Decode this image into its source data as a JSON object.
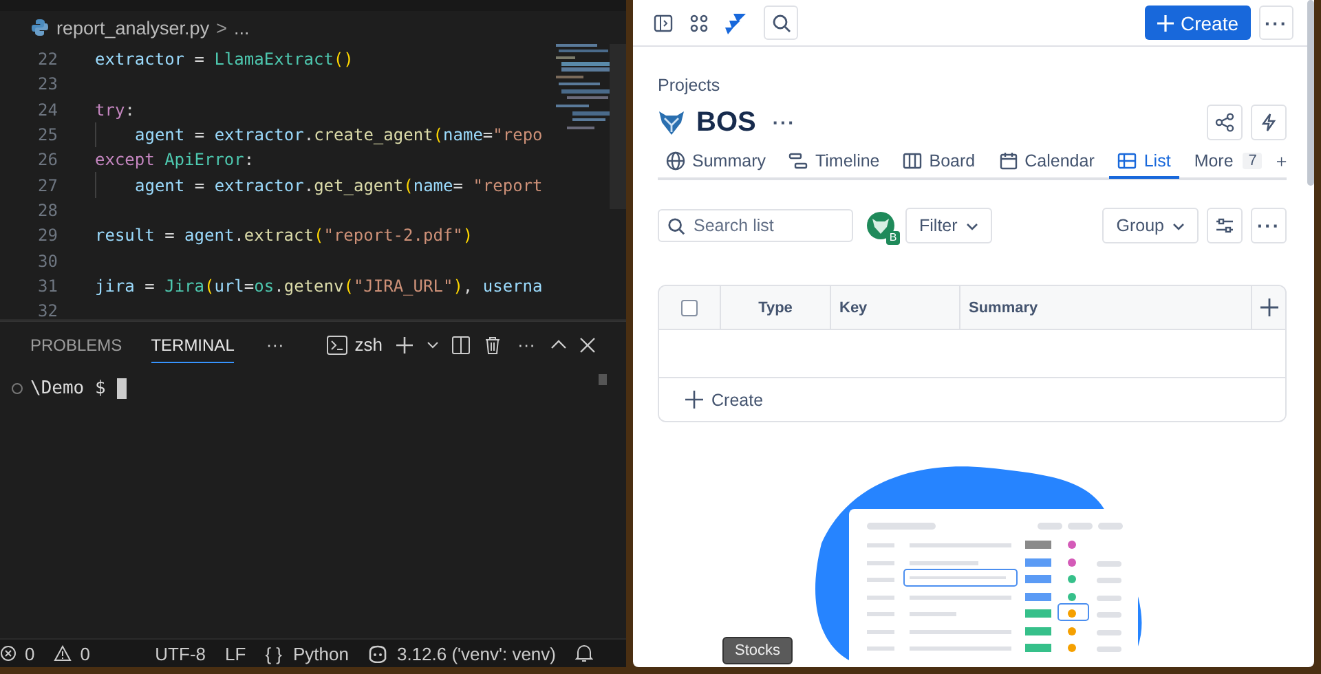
{
  "editor": {
    "breadcrumb": {
      "file": "report_analyser.py",
      "separator": ">",
      "rest": "..."
    },
    "lines": [
      {
        "number": "22",
        "indent": false,
        "tokens": [
          {
            "kind": "var",
            "text": "extractor"
          },
          {
            "kind": "plain",
            "text": " = "
          },
          {
            "kind": "class",
            "text": "LlamaExtract"
          },
          {
            "kind": "paren",
            "text": "()"
          }
        ]
      },
      {
        "number": "23",
        "indent": false
      },
      {
        "number": "24",
        "indent": false,
        "tokens": [
          {
            "kind": "keyword",
            "text": "try"
          },
          {
            "kind": "plain",
            "text": ":"
          }
        ]
      },
      {
        "number": "25",
        "indent": true,
        "tokens": [
          {
            "kind": "var",
            "text": "agent"
          },
          {
            "kind": "plain",
            "text": " = "
          },
          {
            "kind": "var",
            "text": "extractor"
          },
          {
            "kind": "plain",
            "text": "."
          },
          {
            "kind": "func",
            "text": "create_agent"
          },
          {
            "kind": "paren",
            "text": "("
          },
          {
            "kind": "var",
            "text": "name"
          },
          {
            "kind": "plain",
            "text": "="
          },
          {
            "kind": "string",
            "text": "\"repo"
          }
        ]
      },
      {
        "number": "26",
        "indent": false,
        "tokens": [
          {
            "kind": "keyword",
            "text": "except"
          },
          {
            "kind": "class",
            "text": " ApiError"
          },
          {
            "kind": "plain",
            "text": ":"
          }
        ]
      },
      {
        "number": "27",
        "indent": true,
        "tokens": [
          {
            "kind": "var",
            "text": "agent"
          },
          {
            "kind": "plain",
            "text": " = "
          },
          {
            "kind": "var",
            "text": "extractor"
          },
          {
            "kind": "plain",
            "text": "."
          },
          {
            "kind": "func",
            "text": "get_agent"
          },
          {
            "kind": "paren",
            "text": "("
          },
          {
            "kind": "var",
            "text": "name"
          },
          {
            "kind": "plain",
            "text": "= "
          },
          {
            "kind": "string",
            "text": "\"report"
          }
        ]
      },
      {
        "number": "28",
        "indent": false
      },
      {
        "number": "29",
        "indent": false,
        "tokens": [
          {
            "kind": "var",
            "text": "result"
          },
          {
            "kind": "plain",
            "text": " = "
          },
          {
            "kind": "var",
            "text": "agent"
          },
          {
            "kind": "plain",
            "text": "."
          },
          {
            "kind": "func",
            "text": "extract"
          },
          {
            "kind": "paren",
            "text": "("
          },
          {
            "kind": "string",
            "text": "\"report-2.pdf\""
          },
          {
            "kind": "paren",
            "text": ")"
          }
        ]
      },
      {
        "number": "30",
        "indent": false
      },
      {
        "number": "31",
        "indent": false,
        "tokens": [
          {
            "kind": "var",
            "text": "jira"
          },
          {
            "kind": "plain",
            "text": " = "
          },
          {
            "kind": "class",
            "text": "Jira"
          },
          {
            "kind": "paren",
            "text": "("
          },
          {
            "kind": "var",
            "text": "url"
          },
          {
            "kind": "plain",
            "text": "="
          },
          {
            "kind": "class",
            "text": "os"
          },
          {
            "kind": "plain",
            "text": "."
          },
          {
            "kind": "func",
            "text": "getenv"
          },
          {
            "kind": "paren",
            "text": "("
          },
          {
            "kind": "string",
            "text": "\"JIRA_URL\""
          },
          {
            "kind": "paren",
            "text": ")"
          },
          {
            "kind": "plain",
            "text": ", "
          },
          {
            "kind": "var",
            "text": "userna"
          }
        ]
      },
      {
        "number": "32",
        "indent": false
      }
    ]
  },
  "panel": {
    "tabs": [
      {
        "label": "PROBLEMS",
        "selected": false
      },
      {
        "label": "TERMINAL",
        "selected": true
      }
    ],
    "more": "···",
    "shell": "zsh",
    "actions_more": "···"
  },
  "terminal": {
    "prompt": "\\Demo $"
  },
  "status_bar": {
    "errors": "0",
    "warnings": "0",
    "encoding": "UTF-8",
    "eol": "LF",
    "language_icon": "{ }",
    "language": "Python",
    "interpreter": "3.12.6 ('venv': venv)"
  },
  "jira": {
    "create_button": "Create",
    "more": "···",
    "breadcrumb": "Projects",
    "project": "BOS",
    "project_more": "···",
    "tabs": [
      {
        "label": "Summary",
        "selected": false
      },
      {
        "label": "Timeline",
        "selected": false
      },
      {
        "label": "Board",
        "selected": false
      },
      {
        "label": "Calendar",
        "selected": false
      },
      {
        "label": "List",
        "selected": true
      }
    ],
    "more_tab": {
      "label": "More",
      "count": "7"
    },
    "search": {
      "placeholder": "Search list"
    },
    "avatar_badge": "B",
    "filter": "Filter",
    "group": "Group",
    "toolbar_more": "···",
    "table": {
      "select_all_checked": false,
      "columns": [
        "Type",
        "Key",
        "Summary"
      ],
      "create_row": "Create"
    }
  },
  "tooltip": "Stocks"
}
